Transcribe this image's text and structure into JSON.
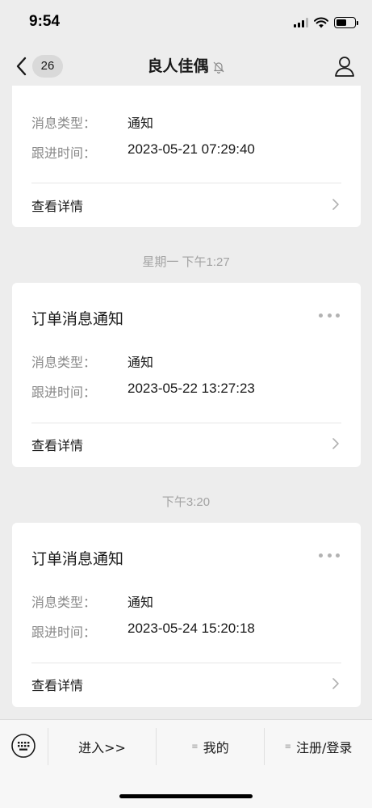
{
  "status": {
    "time": "9:54"
  },
  "nav": {
    "unread_count": "26",
    "title": "良人佳偶"
  },
  "labels": {
    "message_type": "消息类型：",
    "follow_time": "跟进时间：",
    "view_details": "查看详情"
  },
  "cards": [
    {
      "title": "",
      "message_type": "通知",
      "follow_time": "2023-05-21 07:29:40"
    },
    {
      "timestamp": "星期一 下午1:27",
      "title": "订单消息通知",
      "message_type": "通知",
      "follow_time": "2023-05-22 13:27:23"
    },
    {
      "timestamp": "下午3:20",
      "title": "订单消息通知",
      "message_type": "通知",
      "follow_time": "2023-05-24 15:20:18"
    }
  ],
  "menu": {
    "items": [
      {
        "label": "进入>>",
        "has_submenu": false
      },
      {
        "label": "我的",
        "has_submenu": true
      },
      {
        "label": "注册/登录",
        "has_submenu": true
      }
    ]
  },
  "icons": {
    "back": "chevron-left-icon",
    "mute": "bell-off-icon",
    "profile": "person-icon",
    "more": "more-dots-icon",
    "keyboard": "keyboard-icon",
    "detail": "chevron-right-icon"
  }
}
